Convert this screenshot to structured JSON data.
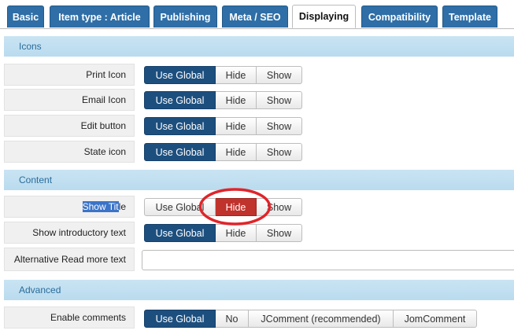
{
  "tabs": [
    "Basic",
    "Item type : Article",
    "Publishing",
    "Meta / SEO",
    "Displaying",
    "Compatibility",
    "Template"
  ],
  "active_tab": "Displaying",
  "sections": {
    "icons": "Icons",
    "content": "Content",
    "advanced": "Advanced"
  },
  "rows": {
    "print_icon": {
      "label": "Print Icon",
      "selected": "Use Global"
    },
    "email_icon": {
      "label": "Email Icon",
      "selected": "Use Global"
    },
    "edit_button": {
      "label": "Edit button",
      "selected": "Use Global"
    },
    "state_icon": {
      "label": "State icon",
      "selected": "Use Global"
    },
    "show_title": {
      "label_selected": "Show Tit",
      "label_rest": "le",
      "selected": "Hide"
    },
    "show_intro": {
      "label": "Show introductory text",
      "selected": "Use Global"
    },
    "alt_readmore": {
      "label": "Alternative Read more text",
      "value": ""
    },
    "enable_comments": {
      "label": "Enable comments",
      "selected": "Use Global"
    }
  },
  "options": {
    "use_global": "Use Global",
    "hide": "Hide",
    "show": "Show",
    "no": "No",
    "jcomment": "JComment (recommended)",
    "jomcomment": "JomComment"
  },
  "colors": {
    "tab_blue": "#2f6ea6",
    "selected_dark_blue": "#1d4f7e",
    "selected_red": "#c0322c",
    "section_bg": "#c9e4f3",
    "annotation_red": "#e0242a"
  }
}
